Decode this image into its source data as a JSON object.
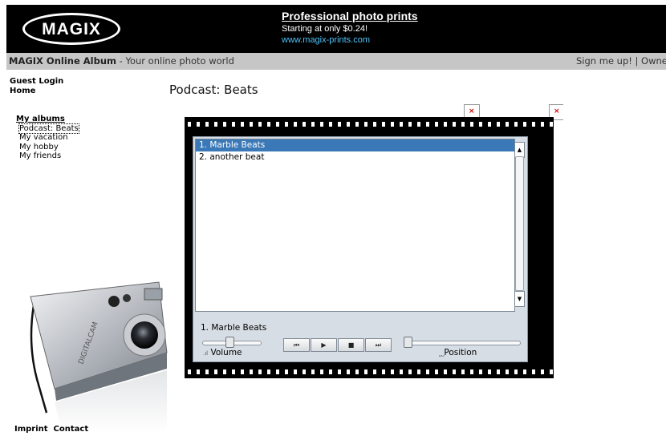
{
  "banner": {
    "logo_text": "MAGIX",
    "ad_title": "Professional photo prints",
    "ad_subtitle": "Starting at only $0.24!",
    "ad_url": "www.magix-prints.com"
  },
  "topbar": {
    "brand": "MAGIX Online Album",
    "tagline": " - Your online photo world",
    "right_text": "Sign me up! | Owne"
  },
  "nav": {
    "guest_login": "Guest Login",
    "home": "Home"
  },
  "albums": {
    "heading": "My albums",
    "items": [
      "Podcast: Beats",
      "My vacation",
      "My hobby",
      "My friends"
    ]
  },
  "footer": {
    "imprint": "Imprint",
    "contact": "Contact"
  },
  "page": {
    "title": "Podcast: Beats"
  },
  "player": {
    "playlist": [
      "1. Marble Beats",
      "2. another beat"
    ],
    "selected_index": 0,
    "now_playing": "1. Marble Beats",
    "volume_label": "Volume",
    "position_label": "Position",
    "volume_level": 0.45,
    "position_level": 0.0,
    "controls": {
      "prev": "⏮",
      "play": "▶",
      "stop": "■",
      "next": "⏭"
    }
  },
  "broken_image_glyph": "×",
  "colors": {
    "banner_bg": "#000000",
    "bar_bg": "#c6c6c6",
    "selection": "#3a78b8",
    "ad_url": "#4fc3f7"
  }
}
